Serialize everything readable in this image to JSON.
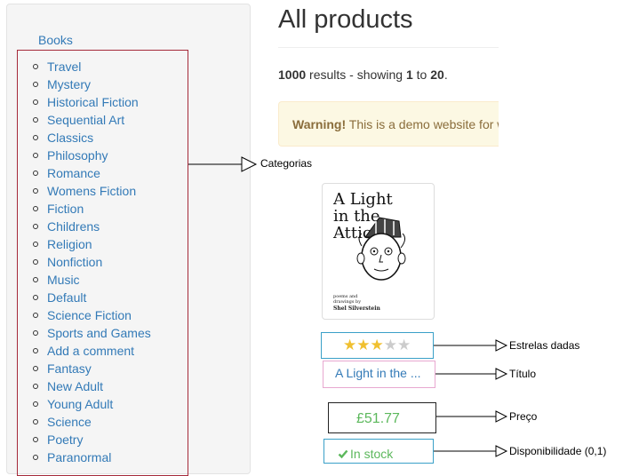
{
  "sidebar": {
    "root_link": "Books",
    "categories": [
      "Travel",
      "Mystery",
      "Historical Fiction",
      "Sequential Art",
      "Classics",
      "Philosophy",
      "Romance",
      "Womens Fiction",
      "Fiction",
      "Childrens",
      "Religion",
      "Nonfiction",
      "Music",
      "Default",
      "Science Fiction",
      "Sports and Games",
      "Add a comment",
      "Fantasy",
      "New Adult",
      "Young Adult",
      "Science",
      "Poetry",
      "Paranormal"
    ]
  },
  "main": {
    "title": "All products",
    "results": {
      "total": "1000",
      "middle": " results - showing ",
      "from": "1",
      "to_word": " to ",
      "to": "20",
      "end": "."
    },
    "alert": {
      "strong": "Warning!",
      "text": " This is a demo website for w"
    }
  },
  "product": {
    "cover_title": "A Light\nin the\nAttic",
    "cover_small": "poems and\ndrawings by",
    "cover_author": "Shel Silverstein",
    "rating": 3,
    "rating_max": 5,
    "title": "A Light in the ...",
    "price": "£51.77",
    "availability": "In stock"
  },
  "annotations": {
    "categories": "Categorias",
    "stars": "Estrelas dadas",
    "title": "Título",
    "price": "Preço",
    "availability": "Disponibilidade (0,1)"
  },
  "colors": {
    "link": "#337ab7",
    "success": "#5cb85c",
    "star_on": "#f0c030",
    "star_off": "#cccccc",
    "warning_bg": "#fcf8e3",
    "warning_text": "#8a6d3b"
  },
  "icons": {
    "star": "star-icon",
    "check": "check-icon",
    "arrow": "triangle-arrow-icon"
  }
}
